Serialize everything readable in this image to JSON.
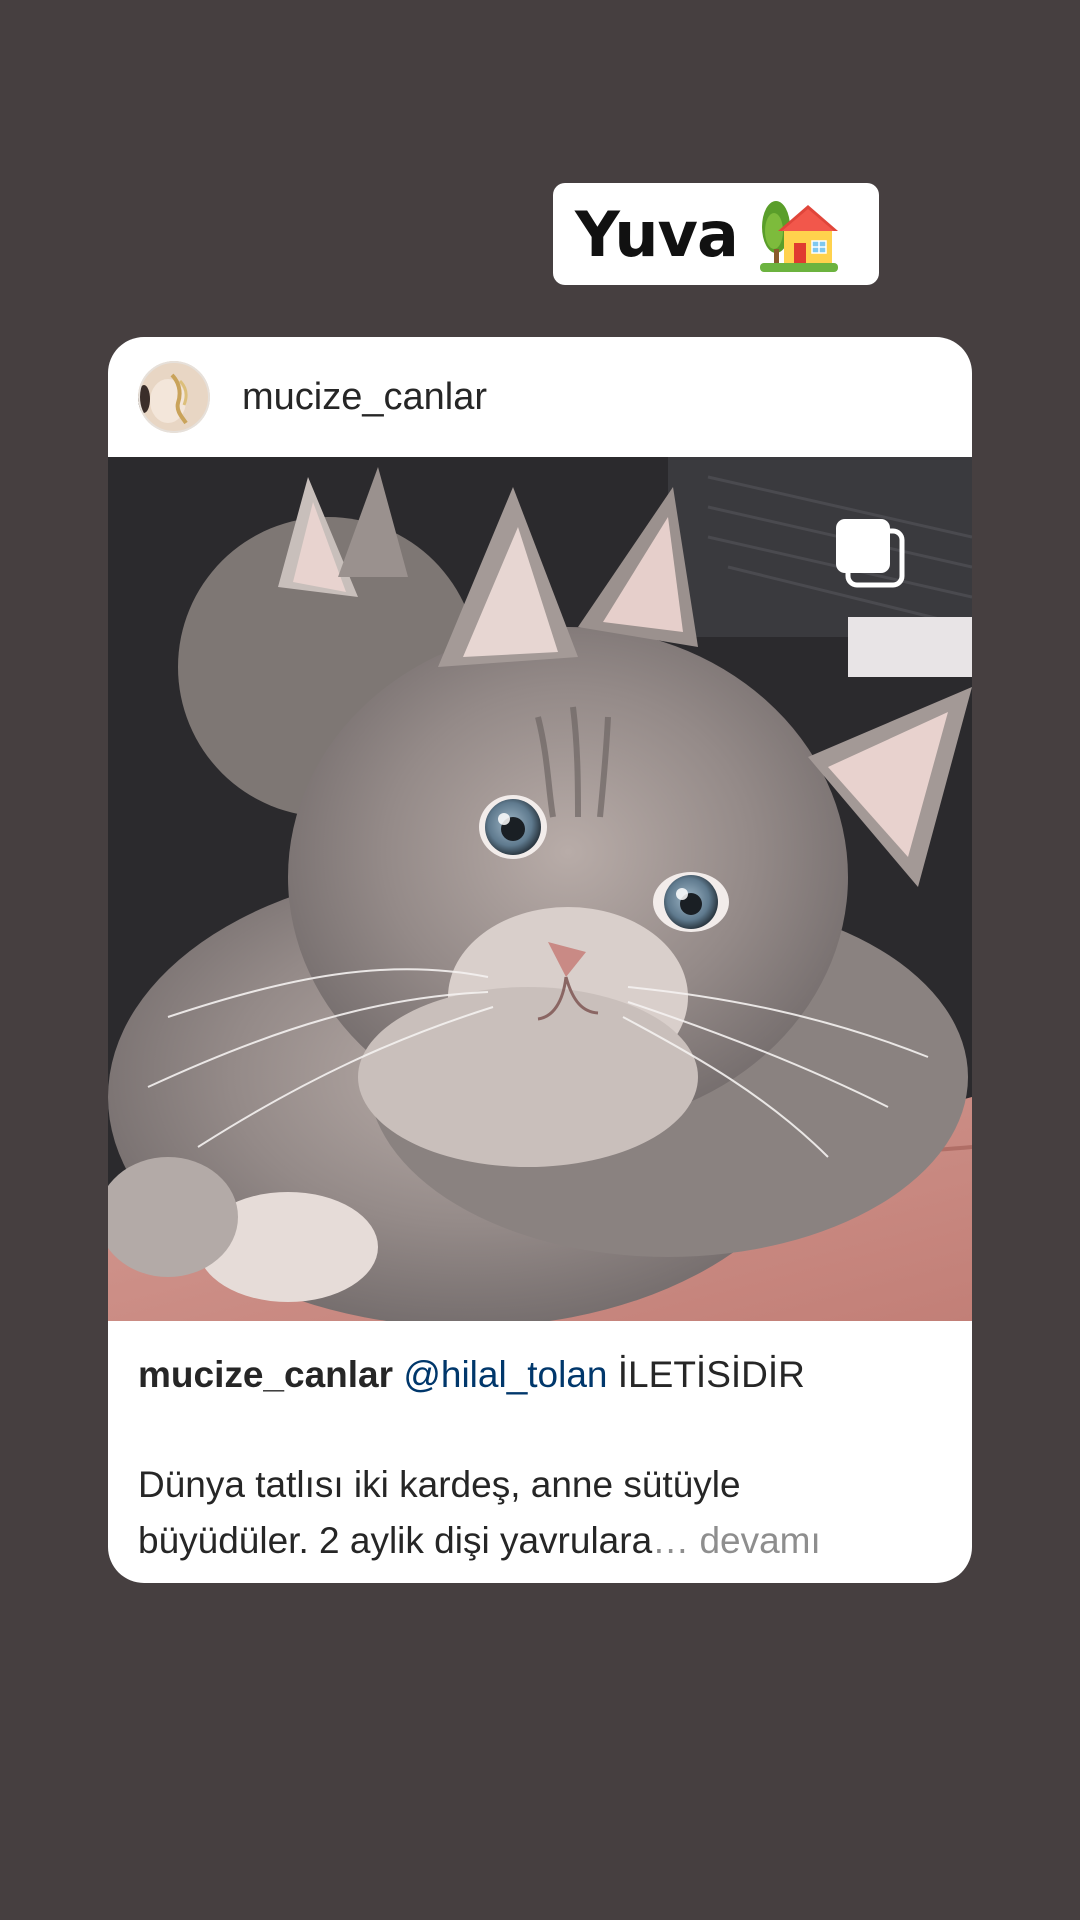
{
  "sticker": {
    "label": "Yuva",
    "icon": "house-with-garden-icon"
  },
  "post": {
    "username": "mucize_canlar",
    "avatar_icon": "profile-avatar",
    "media_icon": "multiple-photos-icon",
    "caption": {
      "user": "mucize_canlar",
      "mention": "@hilal_tolan",
      "headline": "İLETİSİDİR",
      "line1": "Dünya tatlısı iki kardeş, anne sütüyle",
      "line2": "büyüdüler. 2 aylik dişi yavrulara",
      "ellipsis": "…",
      "more": "devamı"
    }
  },
  "colors": {
    "background": "#463f40",
    "mention": "#00376b",
    "more": "#8e8e8e"
  }
}
